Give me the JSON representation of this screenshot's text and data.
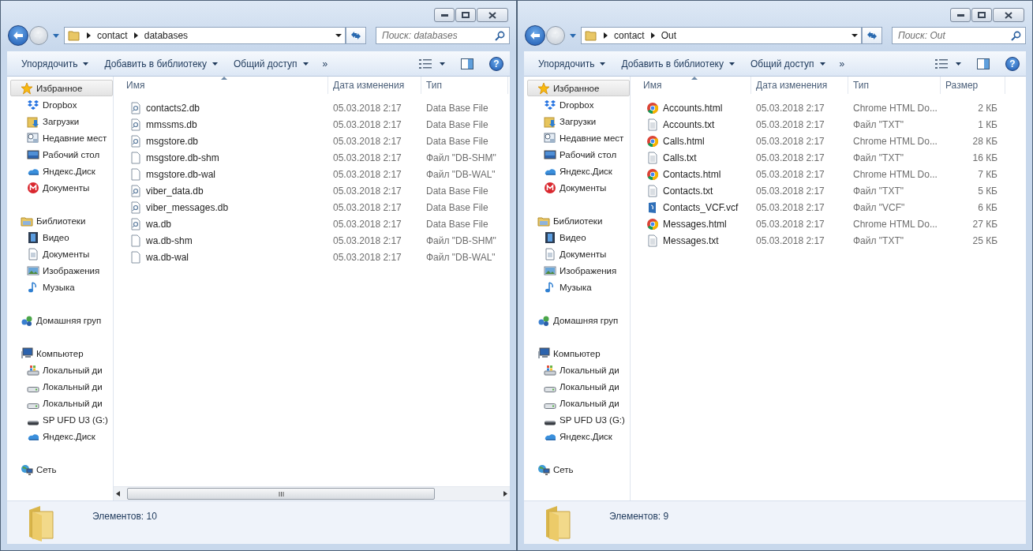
{
  "windows": [
    {
      "breadcrumb": [
        "contact",
        "databases"
      ],
      "search": {
        "placeholder": "Поиск: databases"
      },
      "toolbar": [
        "Упорядочить",
        "Добавить в библиотеку",
        "Общий доступ"
      ],
      "toolbar_more": "»",
      "help": "?",
      "nav": [
        {
          "label": "Избранное",
          "kind": "star",
          "selected": true,
          "children": [
            {
              "label": "Dropbox",
              "kind": "dropbox",
              "selected": false
            },
            {
              "label": "Загрузки",
              "kind": "downloads",
              "selected": false
            },
            {
              "label": "Недавние мест",
              "kind": "recent",
              "selected": false
            },
            {
              "label": "Рабочий стол",
              "kind": "desktop",
              "selected": false
            },
            {
              "label": "Яндекс.Диск",
              "kind": "cloud",
              "selected": false
            },
            {
              "label": "Документы",
              "kind": "mega",
              "selected": false
            }
          ]
        },
        {
          "label": "Библиотеки",
          "kind": "library",
          "selected": false,
          "children": [
            {
              "label": "Видео",
              "kind": "video",
              "selected": false
            },
            {
              "label": "Документы",
              "kind": "document",
              "selected": false
            },
            {
              "label": "Изображения",
              "kind": "picture",
              "selected": false
            },
            {
              "label": "Музыка",
              "kind": "music",
              "selected": false
            }
          ]
        },
        {
          "label": "Домашняя груп",
          "kind": "group",
          "selected": false
        },
        {
          "label": "Компьютер",
          "kind": "computer",
          "selected": false,
          "children": [
            {
              "label": "Локальный ди",
              "kind": "windisk",
              "selected": false
            },
            {
              "label": "Локальный ди",
              "kind": "disk",
              "selected": false
            },
            {
              "label": "Локальный ди",
              "kind": "disk",
              "selected": false
            },
            {
              "label": "SP UFD U3 (G:)",
              "kind": "usb",
              "selected": false
            },
            {
              "label": "Яндекс.Диск",
              "kind": "cloud",
              "selected": false
            }
          ]
        },
        {
          "label": "Сеть",
          "kind": "network",
          "selected": false
        }
      ],
      "columns": [
        {
          "label": "Имя",
          "sorted": true
        },
        {
          "label": "Дата изменения",
          "sorted": false
        },
        {
          "label": "Тип",
          "sorted": false
        }
      ],
      "rows": [
        {
          "kind": "db",
          "cells": [
            "contacts2.db",
            "05.03.2018 2:17",
            "Data Base File"
          ]
        },
        {
          "kind": "db",
          "cells": [
            "mmssms.db",
            "05.03.2018 2:17",
            "Data Base File"
          ]
        },
        {
          "kind": "db",
          "cells": [
            "msgstore.db",
            "05.03.2018 2:17",
            "Data Base File"
          ]
        },
        {
          "kind": "blank",
          "cells": [
            "msgstore.db-shm",
            "05.03.2018 2:17",
            "Файл \"DB-SHM\""
          ]
        },
        {
          "kind": "blank",
          "cells": [
            "msgstore.db-wal",
            "05.03.2018 2:17",
            "Файл \"DB-WAL\""
          ]
        },
        {
          "kind": "db",
          "cells": [
            "viber_data.db",
            "05.03.2018 2:17",
            "Data Base File"
          ]
        },
        {
          "kind": "db",
          "cells": [
            "viber_messages.db",
            "05.03.2018 2:17",
            "Data Base File"
          ]
        },
        {
          "kind": "db",
          "cells": [
            "wa.db",
            "05.03.2018 2:17",
            "Data Base File"
          ]
        },
        {
          "kind": "blank",
          "cells": [
            "wa.db-shm",
            "05.03.2018 2:17",
            "Файл \"DB-SHM\""
          ]
        },
        {
          "kind": "blank",
          "cells": [
            "wa.db-wal",
            "05.03.2018 2:17",
            "Файл \"DB-WAL\""
          ]
        }
      ],
      "horizontal_scrollbar": true,
      "status": "Элементов: 10"
    },
    {
      "breadcrumb": [
        "contact",
        "Out"
      ],
      "search": {
        "placeholder": "Поиск: Out"
      },
      "toolbar": [
        "Упорядочить",
        "Добавить в библиотеку",
        "Общий доступ"
      ],
      "toolbar_more": "»",
      "help": "?",
      "nav": [
        {
          "label": "Избранное",
          "kind": "star",
          "selected": true,
          "children": [
            {
              "label": "Dropbox",
              "kind": "dropbox",
              "selected": false
            },
            {
              "label": "Загрузки",
              "kind": "downloads",
              "selected": false
            },
            {
              "label": "Недавние мест",
              "kind": "recent",
              "selected": false
            },
            {
              "label": "Рабочий стол",
              "kind": "desktop",
              "selected": false
            },
            {
              "label": "Яндекс.Диск",
              "kind": "cloud",
              "selected": false
            },
            {
              "label": "Документы",
              "kind": "mega",
              "selected": false
            }
          ]
        },
        {
          "label": "Библиотеки",
          "kind": "library",
          "selected": false,
          "children": [
            {
              "label": "Видео",
              "kind": "video",
              "selected": false
            },
            {
              "label": "Документы",
              "kind": "document",
              "selected": false
            },
            {
              "label": "Изображения",
              "kind": "picture",
              "selected": false
            },
            {
              "label": "Музыка",
              "kind": "music",
              "selected": false
            }
          ]
        },
        {
          "label": "Домашняя груп",
          "kind": "group",
          "selected": false
        },
        {
          "label": "Компьютер",
          "kind": "computer",
          "selected": false,
          "children": [
            {
              "label": "Локальный ди",
              "kind": "windisk",
              "selected": false
            },
            {
              "label": "Локальный ди",
              "kind": "disk",
              "selected": false
            },
            {
              "label": "Локальный ди",
              "kind": "disk",
              "selected": false
            },
            {
              "label": "SP UFD U3 (G:)",
              "kind": "usb",
              "selected": false
            },
            {
              "label": "Яндекс.Диск",
              "kind": "cloud",
              "selected": false
            }
          ]
        },
        {
          "label": "Сеть",
          "kind": "network",
          "selected": false
        }
      ],
      "columns": [
        {
          "label": "Имя",
          "sorted": true
        },
        {
          "label": "Дата изменения",
          "sorted": false
        },
        {
          "label": "Тип",
          "sorted": false
        },
        {
          "label": "Размер",
          "sorted": false
        }
      ],
      "rows": [
        {
          "kind": "chrome",
          "cells": [
            "Accounts.html",
            "05.03.2018 2:17",
            "Chrome HTML Do...",
            "2 КБ"
          ]
        },
        {
          "kind": "text",
          "cells": [
            "Accounts.txt",
            "05.03.2018 2:17",
            "Файл \"TXT\"",
            "1 КБ"
          ]
        },
        {
          "kind": "chrome",
          "cells": [
            "Calls.html",
            "05.03.2018 2:17",
            "Chrome HTML Do...",
            "28 КБ"
          ]
        },
        {
          "kind": "text",
          "cells": [
            "Calls.txt",
            "05.03.2018 2:17",
            "Файл \"TXT\"",
            "16 КБ"
          ]
        },
        {
          "kind": "chrome",
          "cells": [
            "Contacts.html",
            "05.03.2018 2:17",
            "Chrome HTML Do...",
            "7 КБ"
          ]
        },
        {
          "kind": "text",
          "cells": [
            "Contacts.txt",
            "05.03.2018 2:17",
            "Файл \"TXT\"",
            "5 КБ"
          ]
        },
        {
          "kind": "vcf",
          "cells": [
            "Contacts_VCF.vcf",
            "05.03.2018 2:17",
            "Файл \"VCF\"",
            "6 КБ"
          ]
        },
        {
          "kind": "chrome",
          "cells": [
            "Messages.html",
            "05.03.2018 2:17",
            "Chrome HTML Do...",
            "27 КБ"
          ]
        },
        {
          "kind": "text",
          "cells": [
            "Messages.txt",
            "05.03.2018 2:17",
            "Файл \"TXT\"",
            "25 КБ"
          ]
        }
      ],
      "horizontal_scrollbar": false,
      "status": "Элементов: 9"
    }
  ]
}
